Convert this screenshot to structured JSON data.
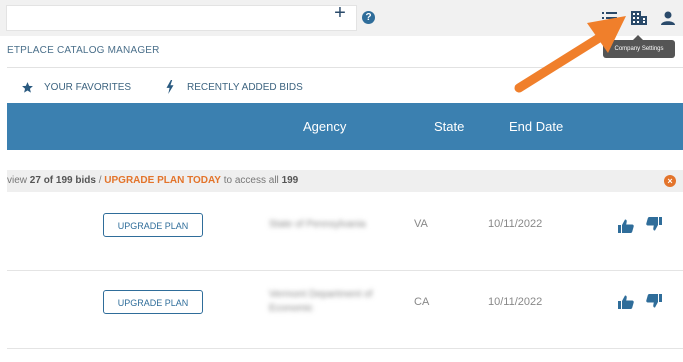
{
  "header": {
    "add_glyph": "+",
    "help_glyph": "?",
    "tooltip": "Company Settings"
  },
  "breadcrumb": "ETPLACE CATALOG MANAGER",
  "quicklinks": {
    "favorites": "YOUR FAVORITES",
    "recent": "RECENTLY ADDED BIDS"
  },
  "table": {
    "columns": [
      "Agency",
      "State",
      "End Date"
    ],
    "banner": {
      "prefix": "view",
      "count": "27 of 199 bids",
      "slash": "/",
      "upgrade": "UPGRADE PLAN TODAY",
      "middle": "to access all",
      "total": "199",
      "close_glyph": "×"
    },
    "rows": [
      {
        "button": "UPGRADE PLAN",
        "agency": "State of Pennsylvania",
        "state": "VA",
        "end_date": "10/11/2022"
      },
      {
        "button": "UPGRADE PLAN",
        "agency": "Vermont Department of Economic",
        "state": "CA",
        "end_date": "10/11/2022"
      }
    ]
  },
  "colors": {
    "header_blue": "#3b80b0",
    "accent_orange": "#e3742b",
    "link_blue": "#2f6d9a"
  },
  "icons": [
    "list-icon",
    "building-icon",
    "user-icon",
    "star-icon",
    "bolt-icon",
    "thumbs-up-icon",
    "thumbs-down-icon",
    "arrow-annotation-icon"
  ]
}
